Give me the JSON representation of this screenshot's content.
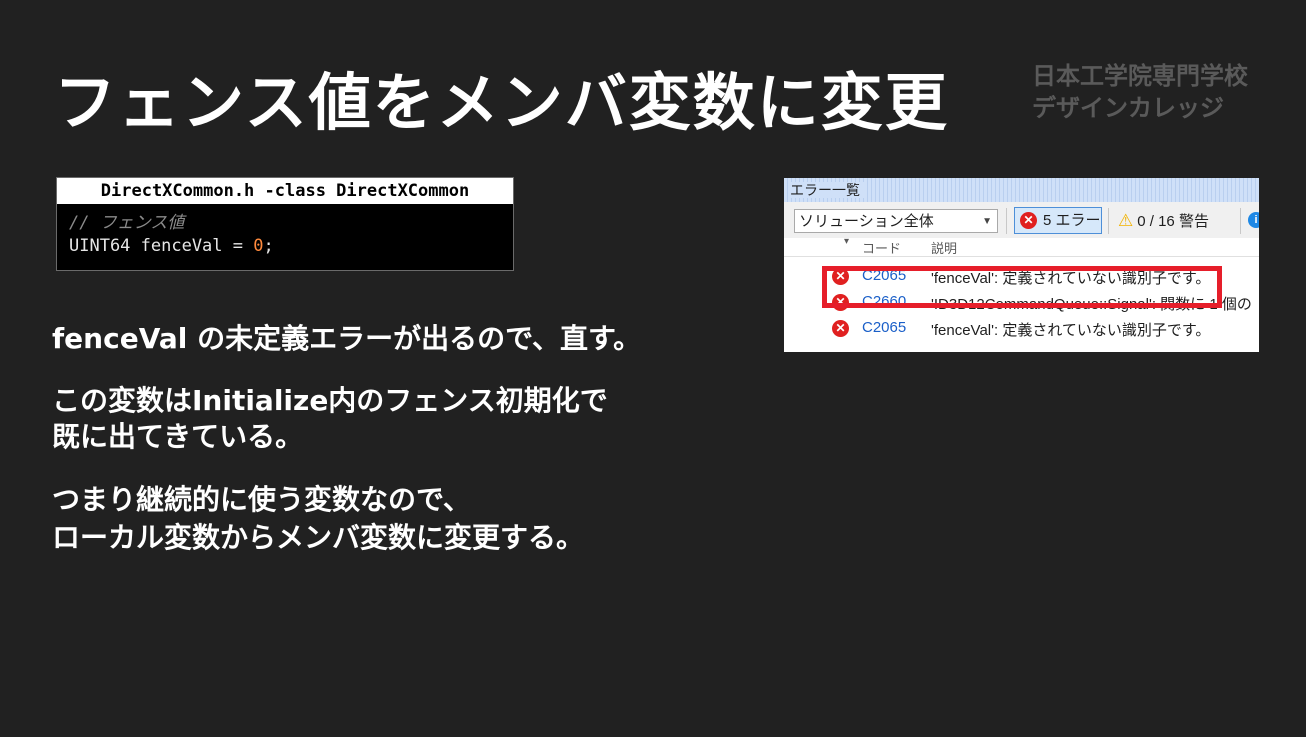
{
  "slide": {
    "title": "フェンス値をメンバ変数に変更",
    "logo_line1": "日本工学院専門学校",
    "logo_line2": "デザインカレッジ"
  },
  "code": {
    "header": "DirectXCommon.h -class DirectXCommon",
    "comment": "// フェンス値",
    "line_type": "UINT64 fenceVal ",
    "line_op": "= ",
    "line_value": "0",
    "line_end": ";"
  },
  "paragraphs": [
    "fenceVal の未定義エラーが出るので、直す。",
    "この変数はInitialize内のフェンス初期化で",
    "既に出てきている。",
    "つまり継続的に使う変数なので、",
    "ローカル変数からメンバ変数に変更する。"
  ],
  "error_list": {
    "title": "エラー一覧",
    "scope": "ソリューション全体",
    "errors_label": "5 エラー",
    "warnings_label": "0 / 16 警告",
    "col_code": "コード",
    "col_desc": "説明",
    "rows": [
      {
        "code": "C2065",
        "desc": "'fenceVal': 定義されていない識別子です。"
      },
      {
        "code": "C2660",
        "desc": "'ID3D12CommandQueue::Signal': 関数に 1 個の"
      },
      {
        "code": "C2065",
        "desc": "'fenceVal': 定義されていない識別子です。"
      }
    ]
  },
  "colors": {
    "background": "#212121",
    "highlight": "#e61e2a",
    "number": "#ff8a3d"
  }
}
